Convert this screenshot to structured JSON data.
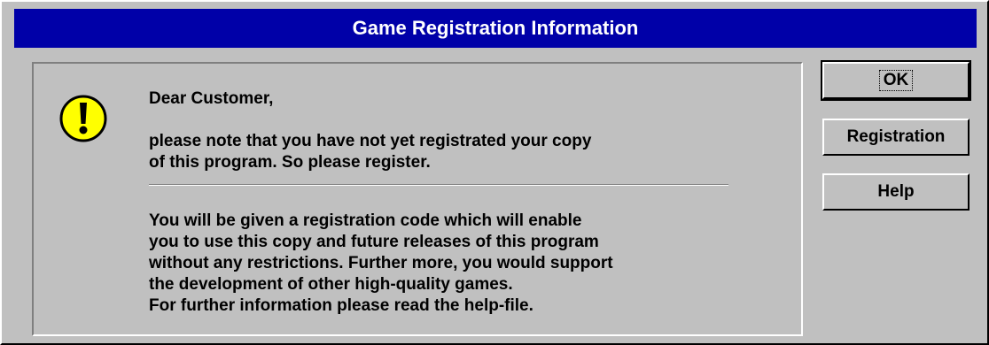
{
  "window": {
    "title": "Game Registration Information"
  },
  "message": {
    "greeting": "Dear Customer,",
    "line1": "please note that you have not yet registrated your copy",
    "line2": "of this program. So please register.",
    "line3": "You will be given a registration code which will enable",
    "line4": "you to use this copy and future releases of this program",
    "line5": "without any restrictions. Further more, you would support",
    "line6": "the development of other high-quality games.",
    "line7": "For further information please read the help-file."
  },
  "buttons": {
    "ok": "OK",
    "registration": "Registration",
    "help": "Help"
  },
  "colors": {
    "titlebar": "#0000a8",
    "face": "#c0c0c0",
    "icon_fill": "#ffff00"
  },
  "icons": {
    "warning": "exclamation-warning-icon"
  }
}
